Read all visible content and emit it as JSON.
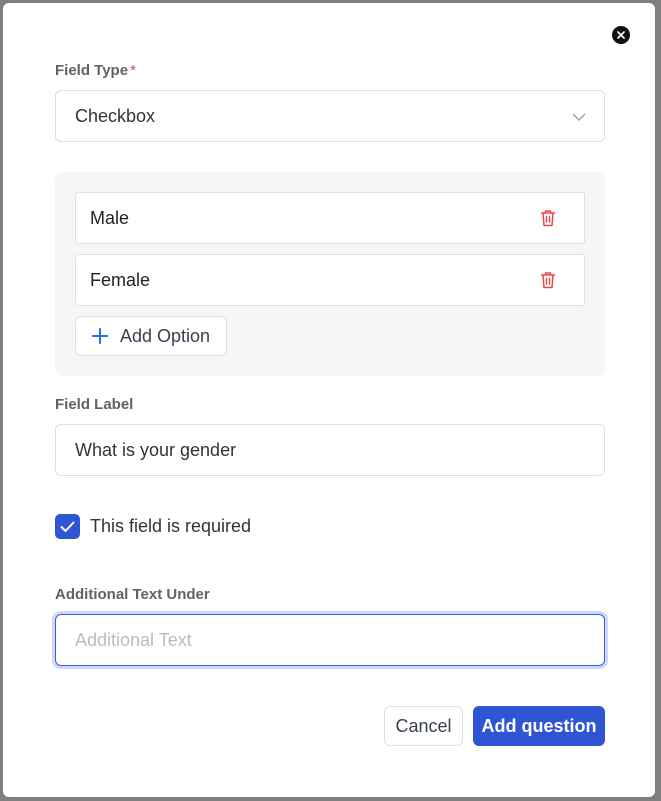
{
  "form": {
    "field_type_label": "Field Type",
    "required_mark": "*",
    "field_type_value": "Checkbox",
    "options": [
      {
        "value": "Male"
      },
      {
        "value": "Female"
      }
    ],
    "add_option_label": "Add Option",
    "field_label_label": "Field Label",
    "field_label_value": "What is your gender",
    "required_checkbox_label": "This field is required",
    "required_checked": true,
    "additional_text_label": "Additional Text Under",
    "additional_text_placeholder": "Additional Text",
    "additional_text_value": ""
  },
  "actions": {
    "cancel_label": "Cancel",
    "submit_label": "Add question"
  },
  "icons": {
    "close": "close-icon",
    "chevron": "chevron-down-icon",
    "trash": "trash-icon",
    "plus": "plus-icon",
    "check": "check-icon"
  },
  "colors": {
    "primary": "#2f55d4",
    "danger": "#e5484d",
    "plus_icon": "#1a73e8"
  }
}
